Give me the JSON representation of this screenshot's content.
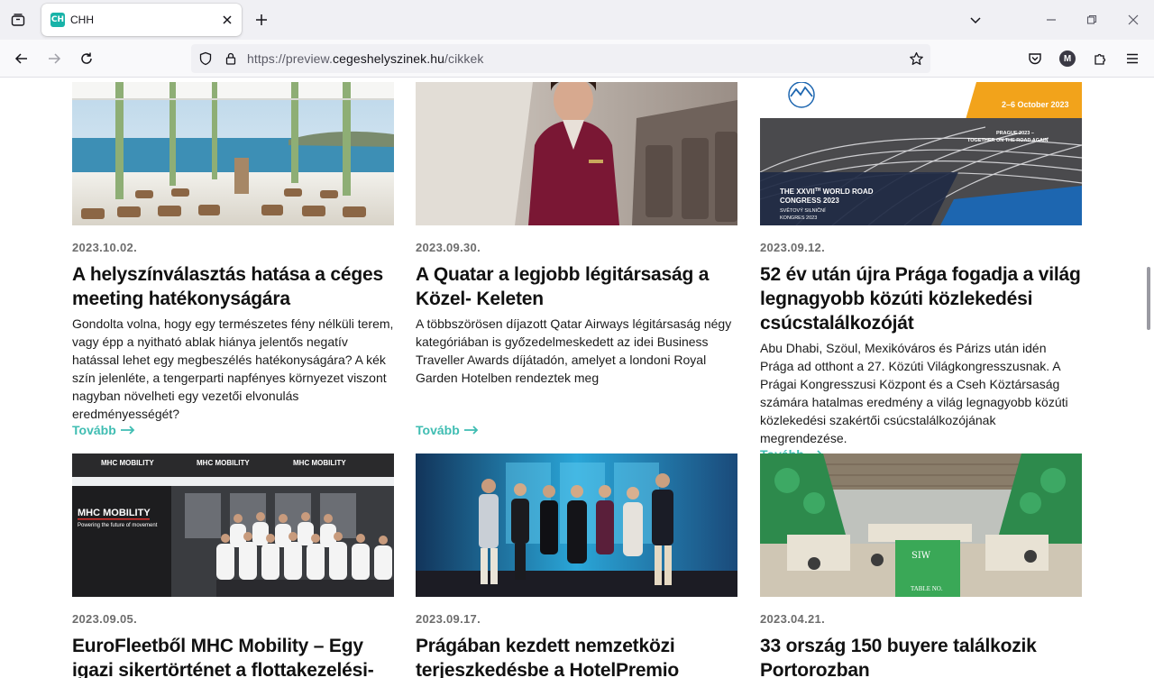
{
  "browser": {
    "tab": {
      "title": "CHH",
      "favicon_text": "CH",
      "favicon_color": "#18b3a8"
    },
    "url": {
      "scheme": "https://",
      "subdomain": "preview.",
      "host": "cegeshelyszinek.hu",
      "path": "/cikkek"
    },
    "account_initial": "M"
  },
  "colors": {
    "accent": "#3fbdb2",
    "date": "#6d6d6d",
    "title": "#111111"
  },
  "articles": [
    {
      "date": "2023.10.02.",
      "title": "A helyszínválasztás hatása a céges meeting hatékonyságára",
      "excerpt": "Gondolta volna, hogy egy természetes fény nélküli terem, vagy épp a nyitható ablak hiánya jelentős negatív hatással lehet egy megbeszélés hatékonyságára? A kék szín jelenléte, a tengerparti napfényes környezet viszont nagyban növelheti egy vezetői elvonulás eredményességét?",
      "more": "Tovább"
    },
    {
      "date": "2023.09.30.",
      "title": "A Quatar a legjobb légitársaság a Közel- Keleten",
      "excerpt": "A többszörösen díjazott Qatar Airways légitársaság négy kategóriában is győzedelmeskedett az idei Business Traveller Awards díjátadón, amelyet a londoni Royal Garden Hotelben rendeztek meg",
      "more": "Tovább"
    },
    {
      "date": "2023.09.12.",
      "title": "52 év után újra Prága fogadja a világ legnagyobb közúti közlekedési csúcstalálkozóját",
      "excerpt": "Abu Dhabi, Szöul, Mexikóváros és Párizs után idén Prága ad otthont a 27. Közúti Világkongresszusnak. A Prágai Kongresszusi Központ és a Cseh Köztársaság számára hatalmas eredmény a világ legnagyobb közúti közlekedési szakértői csúcstalálkozójának megrendezése.",
      "more": "Tovább",
      "image_text": {
        "dates": "2–6 October 2023",
        "tagline_1": "PRAGUE 2023 –",
        "tagline_2": "TOGETHER ON THE ROAD AGAIN",
        "congress_1": "THE XXVII",
        "congress_sup": "TH",
        "congress_2": " WORLD ROAD",
        "congress_3": "CONGRESS 2023",
        "congress_cz_1": "SVĚTOVÝ SILNIČNÍ",
        "congress_cz_2": "KONGRES 2023"
      }
    },
    {
      "date": "2023.09.05.",
      "title": "EuroFleetből MHC Mobility – Egy igazi sikertörténet a flottakezelési-",
      "image_text": {
        "banner": "MHC MOBILITY",
        "banner_sub": "Powering the future of movement"
      }
    },
    {
      "date": "2023.09.17.",
      "title": "Prágában kezdett nemzetközi terjeszkedésbe a HotelPremio Group"
    },
    {
      "date": "2023.04.21.",
      "title": "33 ország 150 buyere találkozik Portorozban",
      "image_text": {
        "sign": "SIW",
        "table": "TABLE NO."
      }
    }
  ]
}
